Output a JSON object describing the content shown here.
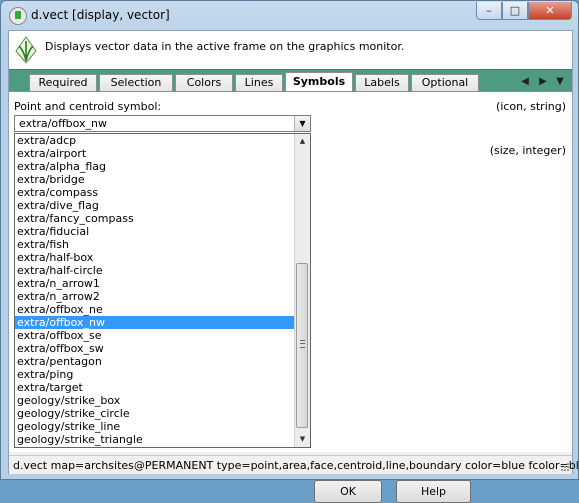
{
  "window": {
    "title": "d.vect [display, vector]",
    "minimize": "–",
    "maximize": "□",
    "close": "✕"
  },
  "info": {
    "description": "Displays vector data in the active frame on the graphics monitor."
  },
  "tabs": [
    "Required",
    "Selection",
    "Colors",
    "Lines",
    "Symbols",
    "Labels",
    "Optional"
  ],
  "active_tab": "Symbols",
  "tab_nav": {
    "prev": "◀",
    "next": "▶",
    "list": "▼"
  },
  "symbols": {
    "field_label": "Point and centroid symbol:",
    "field_type": "(icon, string)",
    "selected_value": "extra/offbox_nw",
    "size_type": "(size, integer)",
    "options": [
      "extra/adcp",
      "extra/airport",
      "extra/alpha_flag",
      "extra/bridge",
      "extra/compass",
      "extra/dive_flag",
      "extra/fancy_compass",
      "extra/fiducial",
      "extra/fish",
      "extra/half-box",
      "extra/half-circle",
      "extra/n_arrow1",
      "extra/n_arrow2",
      "extra/offbox_ne",
      "extra/offbox_nw",
      "extra/offbox_se",
      "extra/offbox_sw",
      "extra/pentagon",
      "extra/ping",
      "extra/target",
      "geology/strike_box",
      "geology/strike_circle",
      "geology/strike_line",
      "geology/strike_triangle"
    ],
    "highlighted_index": 14
  },
  "buttons": {
    "ok": "OK",
    "help": "Help"
  },
  "status": {
    "command": "d.vect map=archsites@PERMANENT type=point,area,face,centroid,line,boundary color=blue fcolor=bl"
  },
  "icons": {
    "app": "grass-app-icon",
    "module": "grass-module-icon",
    "dropdown_arrow": "chevron-down-icon"
  }
}
